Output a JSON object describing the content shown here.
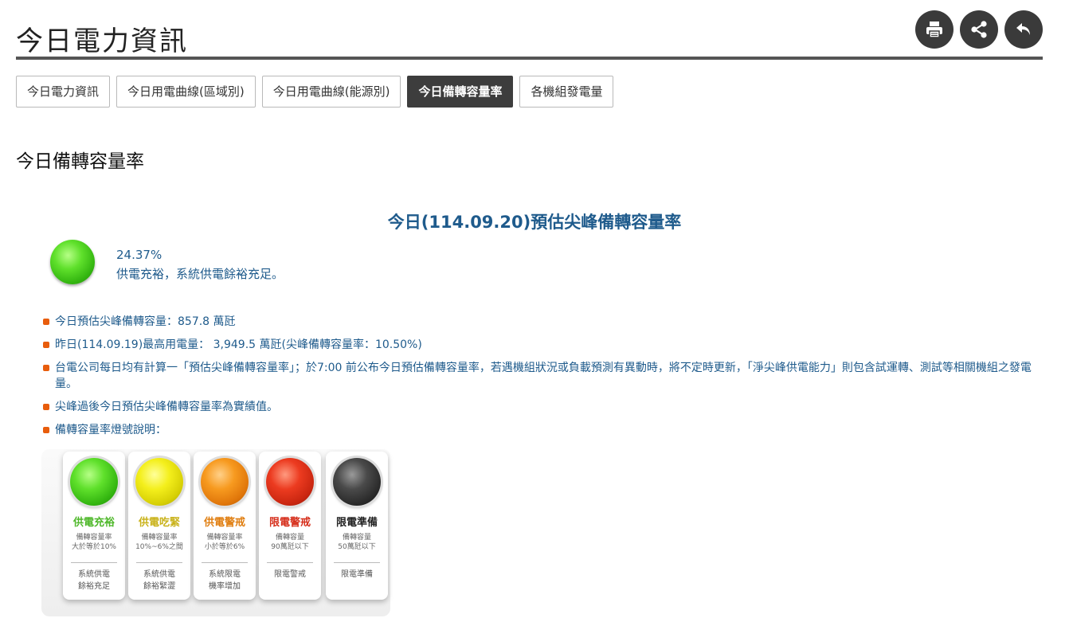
{
  "header": {
    "title": "今日電力資訊",
    "buttons": [
      {
        "name": "print",
        "icon": "printer-icon"
      },
      {
        "name": "share",
        "icon": "share-icon"
      },
      {
        "name": "back",
        "icon": "back-arrow-icon"
      }
    ]
  },
  "tabs": [
    {
      "label": "今日電力資訊",
      "active": false
    },
    {
      "label": "今日用電曲線(區域別)",
      "active": false
    },
    {
      "label": "今日用電曲線(能源別)",
      "active": false
    },
    {
      "label": "今日備轉容量率",
      "active": true
    },
    {
      "label": "各機組發電量",
      "active": false
    }
  ],
  "section_title": "今日備轉容量率",
  "forecast": {
    "title": "今日(114.09.20)預估尖峰備轉容量率",
    "percent": "24.37%",
    "status": "供電充裕，系統供電餘裕充足。",
    "lamp_color": "green"
  },
  "notes": [
    "今日預估尖峰備轉容量：857.8 萬瓩",
    "昨日(114.09.19)最高用電量： 3,949.5 萬瓩(尖峰備轉容量率：10.50%)",
    "台電公司每日均有計算一「預估尖峰備轉容量率」；於7:00 前公布今日預估備轉容量率，若遇機組狀況或負載預測有異動時，將不定時更新，「淨尖峰供電能力」則包含試運轉、測試等相關機組之發電量。",
    "尖峰過後今日預估尖峰備轉容量率為實績值。",
    "備轉容量率燈號說明："
  ],
  "legend": [
    {
      "title": "供電充裕",
      "color": "#4fb82b",
      "desc1": "備轉容量率",
      "desc2": "大於等於10%",
      "foot1": "系統供電",
      "foot2": "餘裕充足",
      "bulb": "green"
    },
    {
      "title": "供電吃緊",
      "color": "#c9b21a",
      "desc1": "備轉容量率",
      "desc2": "10%~6%之間",
      "foot1": "系統供電",
      "foot2": "餘裕緊澀",
      "bulb": "yellow"
    },
    {
      "title": "供電警戒",
      "color": "#e07f12",
      "desc1": "備轉容量率",
      "desc2": "小於等於6%",
      "foot1": "系統限電",
      "foot2": "機率增加",
      "bulb": "orange"
    },
    {
      "title": "限電警戒",
      "color": "#d62f1c",
      "desc1": "備轉容量",
      "desc2": "90萬瓩以下",
      "foot1": "限電警戒",
      "foot2": "",
      "bulb": "red"
    },
    {
      "title": "限電準備",
      "color": "#222222",
      "desc1": "備轉容量",
      "desc2": "50萬瓩以下",
      "foot1": "限電準備",
      "foot2": "",
      "bulb": "black"
    }
  ],
  "colors": {
    "accent": "#1f5b8c",
    "bullet": "#e85d0c",
    "active_tab": "#3d3d3d"
  }
}
